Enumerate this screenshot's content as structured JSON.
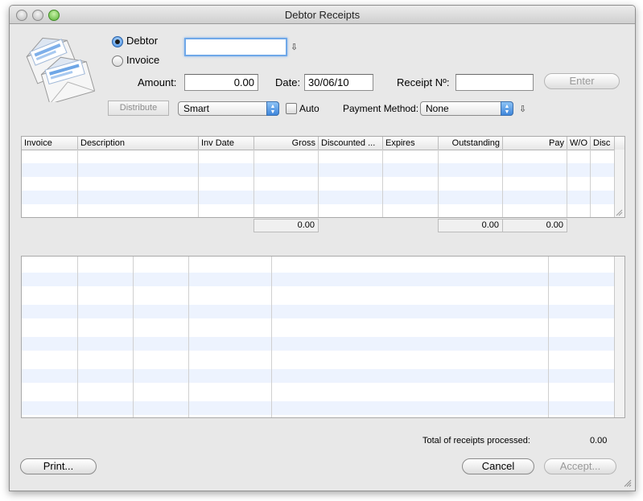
{
  "window": {
    "title": "Debtor Receipts"
  },
  "mode": {
    "debtor_label": "Debtor",
    "invoice_label": "Invoice",
    "selected": "Debtor"
  },
  "debtor_field": {
    "value": ""
  },
  "amount": {
    "label": "Amount:",
    "value": "0.00"
  },
  "date": {
    "label": "Date:",
    "value": "30/06/10"
  },
  "receipt": {
    "label": "Receipt Nº:",
    "value": ""
  },
  "buttons": {
    "enter": "Enter",
    "distribute": "Distribute",
    "print": "Print...",
    "cancel": "Cancel",
    "accept": "Accept..."
  },
  "distribution": {
    "selected": "Smart"
  },
  "auto": {
    "label": "Auto",
    "checked": false
  },
  "payment_method": {
    "label": "Payment Method:",
    "selected": "None"
  },
  "invoice_table": {
    "columns": [
      "Invoice",
      "Description",
      "Inv Date",
      "Gross",
      "Discounted ...",
      "Expires",
      "Outstanding",
      "Pay",
      "W/O",
      "Disc"
    ],
    "totals": {
      "gross": "0.00",
      "outstanding": "0.00",
      "pay": "0.00"
    }
  },
  "footer": {
    "total_label": "Total of receipts processed:",
    "total_value": "0.00"
  },
  "colors": {
    "accent": "#3f86db",
    "focus": "#6fa8e8",
    "stripe": "#edf3fe"
  }
}
